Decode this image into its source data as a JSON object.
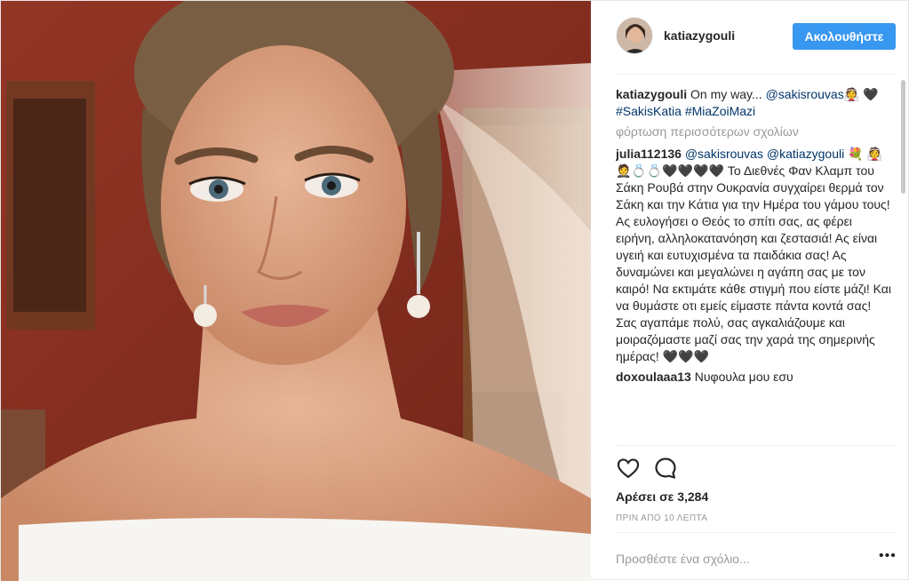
{
  "post": {
    "username": "katiazygouli",
    "follow_label": "Ακολουθήστε",
    "load_more": "φόρτωση περισσότερων σχολίων",
    "likes": "Αρέσει σε 3,284",
    "time": "ΠΡΙΝ ΑΠΟ 10 ΛΕΠΤΑ",
    "add_comment": "Προσθέστε ένα σχόλιο...",
    "more_glyph": "•••"
  },
  "caption": {
    "user": "katiazygouli",
    "text": "On my way... ",
    "mention": "@sakisrouvas",
    "emoji": "👰 🖤",
    "hashtags": "#SakisKatia #MiaZoiMazi"
  },
  "comments": [
    {
      "user": "julia112136",
      "mentions": "@sakisrouvas @katiazygouli",
      "text": " 💐 👰🤵💍💍🖤🖤🖤🖤 Το Διεθνές Φαν Κλαμπ του Σάκη Ρουβά στην Ουκρανία συγχαίρει θερμά τον Σάκη και την Κάτια για την Ημέρα του γάμου τους! Ας ευλογήσει ο Θεός το σπίτι σας, ας φέρει ειρήνη, αλληλοκατανόηση και ζεστασιά! Ας είναι υγειή και ευτυχισμένα τα παιδάκια σας! Ας δυναμώνει και μεγαλώνει η αγάπη σας με τον καιρό! Να εκτιμάτε κάθε στιγμή που είστε μάζι! Και να θυμάστε οτι εμείς είμαστε πάντα κοντά σας! Σας αγαπάμε πολύ, σας αγκαλιάζουμε και μοιραζόμαστε μαζί σας την χαρά της σημερινής ημέρας! 🖤🖤🖤"
    },
    {
      "user": "doxoulaaa13",
      "mentions": "",
      "text": " Νυφουλα μου εσυ"
    }
  ],
  "colors": {
    "follow_bg": "#3897f0",
    "link": "#003569",
    "muted": "#999999"
  },
  "icons": [
    "heart-outline-icon",
    "comment-bubble-icon",
    "more-dots-icon"
  ]
}
